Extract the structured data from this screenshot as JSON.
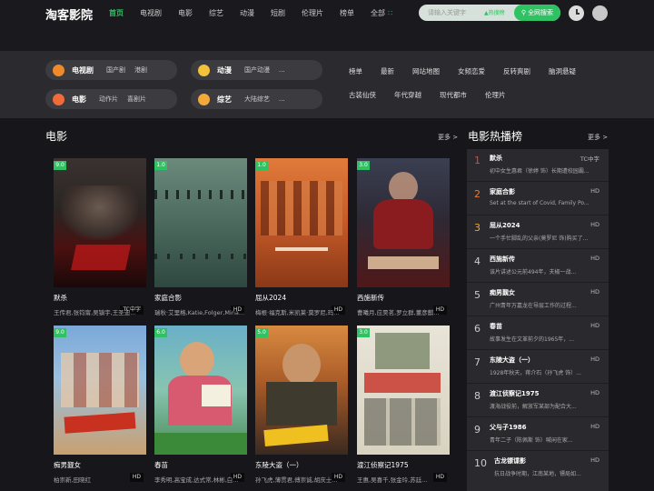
{
  "header": {
    "logo": "淘客影院",
    "nav": [
      "首页",
      "电视剧",
      "电影",
      "综艺",
      "动漫",
      "短剧",
      "伦理片",
      "榜单"
    ],
    "nav_more": "全部",
    "nav_more_icon": "grid-dots-icon",
    "search_placeholder": "请输入关键字",
    "hot_tag": "热搜榜",
    "search_button": "全网搜索",
    "accent": "#2fc262"
  },
  "categories": {
    "pills": [
      {
        "title": "电视剧",
        "subs": [
          "国产剧",
          "港剧"
        ],
        "emoji_color": "#f0892a"
      },
      {
        "title": "动漫",
        "subs": [
          "国产动漫",
          "..."
        ],
        "emoji_color": "#f2c23a"
      },
      {
        "title": "电影",
        "subs": [
          "动作片",
          "喜剧片"
        ],
        "emoji_color": "#f06a3a"
      },
      {
        "title": "综艺",
        "subs": [
          "大陆综艺",
          "..."
        ],
        "emoji_color": "#f2a93a"
      }
    ],
    "links": [
      "榜单",
      "最新",
      "网站地图",
      "女频恋爱",
      "反转爽剧",
      "脑洞悬疑",
      "古装仙侠",
      "年代穿越",
      "现代都市",
      "伦理片"
    ]
  },
  "movies": {
    "title": "电影",
    "more": "更多 >",
    "items": [
      {
        "title": "默杀",
        "actors": "王传君,张钧甯,吴镇宇,王圣迪...",
        "score": "9.0",
        "quality": "TC中字"
      },
      {
        "title": "家庭合影",
        "actors": "瑞秋·艾里格,Katie,Folger,Mina...",
        "score": "1.0",
        "quality": "HD"
      },
      {
        "title": "屈从2024",
        "actors": "梅根·福克斯,米凯莱·莫罗尼,玛...",
        "score": "1.0",
        "quality": "HD"
      },
      {
        "title": "西施新传",
        "actors": "曹曦月,应昊茗,罗立群,董彦麒...",
        "score": "3.0",
        "quality": "HD"
      },
      {
        "title": "痴男觐女",
        "actors": "柏崇新,田晓红",
        "score": "9.0",
        "quality": "HD"
      },
      {
        "title": "春苗",
        "actors": "李秀明,高宝成,达式常,林彬,白...",
        "score": "6.0",
        "quality": "HD"
      },
      {
        "title": "东陵大盗（一）",
        "actors": "孙飞虎,薄贯君,傅崇诚,胡庆士...",
        "score": "5.0",
        "quality": "HD"
      },
      {
        "title": "渡江侦察记1975",
        "actors": "王惠,吴喜千,张金玲,苏廷...",
        "score": "3.0",
        "quality": "HD"
      }
    ]
  },
  "hot": {
    "title": "电影热播榜",
    "more": "更多 >",
    "items": [
      {
        "rank": "1",
        "name": "默杀",
        "tag": "TC中字",
        "desc": "初中女生惠君（徐婷 饰）长期遭校园霸..."
      },
      {
        "rank": "2",
        "name": "家庭合影",
        "tag": "HD",
        "desc": "Set at the start of Covid, Family Po..."
      },
      {
        "rank": "3",
        "name": "屈从2024",
        "tag": "HD",
        "desc": "一个手忙脚乱的父亲(莫罗尼 饰)购买了..."
      },
      {
        "rank": "4",
        "name": "西施新传",
        "tag": "HD",
        "desc": "该片讲述公元前494年，夫椒一战..."
      },
      {
        "rank": "5",
        "name": "痴男觐女",
        "tag": "HD",
        "desc": "广州青年万嘉龙在导层工作的过程..."
      },
      {
        "rank": "6",
        "name": "春苗",
        "tag": "HD",
        "desc": "故事发生在文革前夕的1965年，..."
      },
      {
        "rank": "7",
        "name": "东陵大盗（一）",
        "tag": "HD",
        "desc": "1928年秋天，蒋介石（孙飞虎 饰）..."
      },
      {
        "rank": "8",
        "name": "渡江侦察记1975",
        "tag": "HD",
        "desc": "渡海战役前，解放军某部为配合大..."
      },
      {
        "rank": "9",
        "name": "父与子1986",
        "tag": "HD",
        "desc": "青年二子（陈佩斯 饰）喊闲在家..."
      },
      {
        "rank": "10",
        "name": "古龙镖谍影",
        "tag": "HD",
        "desc": "抗日战争时期，江南某地，镖局如..."
      }
    ]
  }
}
